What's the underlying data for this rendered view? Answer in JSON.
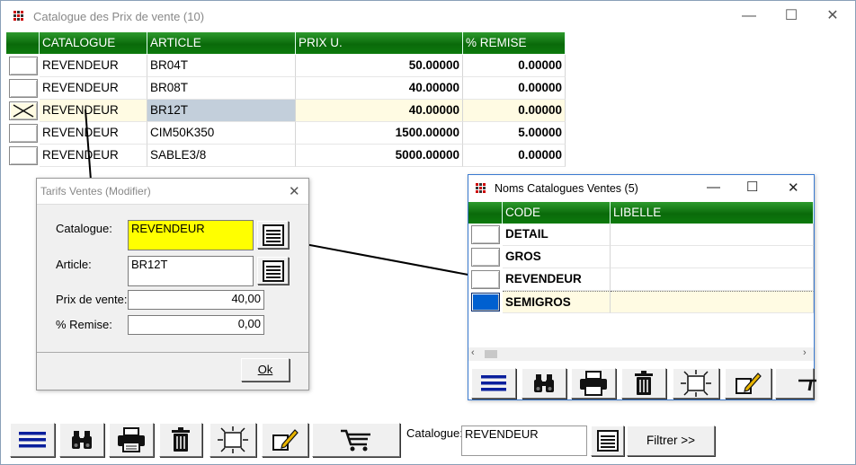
{
  "main": {
    "title": "Catalogue des Prix de vente (10)",
    "columns": [
      "CATALOGUE",
      "ARTICLE",
      "PRIX U.",
      "% REMISE"
    ],
    "rows": [
      {
        "catalogue": "REVENDEUR",
        "article": "BR04T",
        "prix": "50.00000",
        "remise": "0.00000"
      },
      {
        "catalogue": "REVENDEUR",
        "article": "BR08T",
        "prix": "40.00000",
        "remise": "0.00000"
      },
      {
        "catalogue": "REVENDEUR",
        "article": "BR12T",
        "prix": "40.00000",
        "remise": "0.00000"
      },
      {
        "catalogue": "REVENDEUR",
        "article": "CIM50K350",
        "prix": "1500.00000",
        "remise": "5.00000"
      },
      {
        "catalogue": "REVENDEUR",
        "article": "SABLE3/8",
        "prix": "5000.00000",
        "remise": "0.00000"
      }
    ],
    "selected_row": 3,
    "filter_label": "Catalogue:",
    "filter_value": "REVENDEUR",
    "filter_button": "Filtrer >>",
    "window_controls": {
      "minimize": "—",
      "maximize": "☐",
      "close": "✕"
    }
  },
  "tarifs": {
    "title": "Tarifs Ventes  (Modifier)",
    "catalogue_label": "Catalogue:",
    "catalogue_value": "REVENDEUR",
    "article_label": "Article:",
    "article_value": "BR12T",
    "prix_label": "Prix de vente:",
    "prix_value": "40,00",
    "remise_label": "% Remise:",
    "remise_value": "0,00",
    "ok_label": "Ok",
    "close": "✕"
  },
  "noms": {
    "title": "Noms Catalogues Ventes (5)",
    "columns": [
      "CODE",
      "LIBELLE"
    ],
    "rows": [
      {
        "code": "DETAIL",
        "libelle": ""
      },
      {
        "code": "GROS",
        "libelle": ""
      },
      {
        "code": "REVENDEUR",
        "libelle": ""
      },
      {
        "code": "SEMIGROS",
        "libelle": ""
      }
    ],
    "selected_row": 4,
    "window_controls": {
      "minimize": "—",
      "maximize": "☐",
      "close": "✕"
    }
  },
  "colors": {
    "header_green": "#0a6a0a",
    "highlight_row": "#fffbe3",
    "yellow_field": "#ffff00",
    "selector_blue": "#0060d0"
  }
}
